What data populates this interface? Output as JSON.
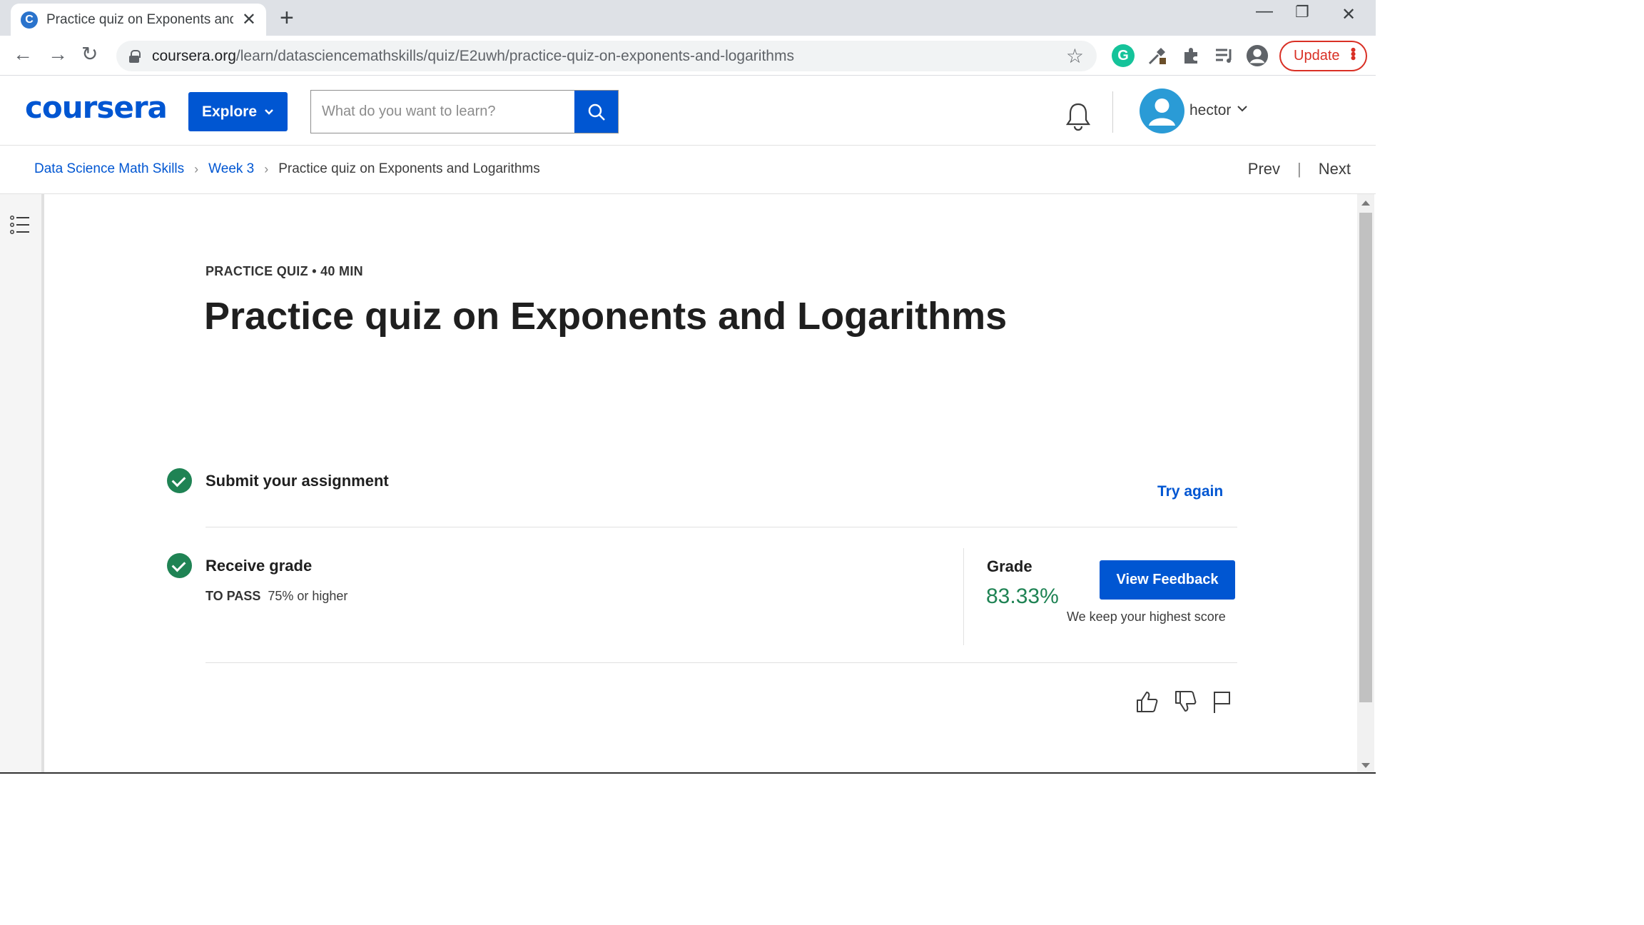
{
  "browser": {
    "tab_title": "Practice quiz on Exponents and L",
    "tab_favicon": "C",
    "url_host": "coursera.org",
    "url_path": "/learn/datasciencemathskills/quiz/E2uwh/practice-quiz-on-exponents-and-logarithms",
    "update_label": "Update",
    "extension_grammarly": "G"
  },
  "header": {
    "logo": "coursera",
    "explore_label": "Explore",
    "search_placeholder": "What do you want to learn?",
    "username": "hector"
  },
  "breadcrumb": {
    "items": [
      "Data Science Math Skills",
      "Week 3"
    ],
    "current": "Practice quiz on Exponents and Logarithms",
    "prev_label": "Prev",
    "next_label": "Next"
  },
  "quiz": {
    "meta": "PRACTICE QUIZ • 40 MIN",
    "title": "Practice quiz on Exponents and Logarithms",
    "submit_step": "Submit your assignment",
    "try_again": "Try again",
    "receive_step": "Receive grade",
    "to_pass_label": "TO PASS",
    "to_pass_value": "75% or higher",
    "grade_label": "Grade",
    "grade_value": "83.33%",
    "view_feedback": "View Feedback",
    "highest_note": "We keep your highest score"
  },
  "colors": {
    "brand_blue": "#0056d2",
    "success_green": "#1f8354",
    "update_red": "#d93025"
  },
  "icons": [
    "back-icon",
    "forward-icon",
    "reload-icon",
    "lock-icon",
    "star-icon",
    "grammarly-icon",
    "eyedropper-icon",
    "extensions-icon",
    "reading-list-icon",
    "profile-icon",
    "bell-icon",
    "search-icon",
    "outline-icon",
    "thumbs-up-icon",
    "thumbs-down-icon",
    "flag-icon"
  ]
}
